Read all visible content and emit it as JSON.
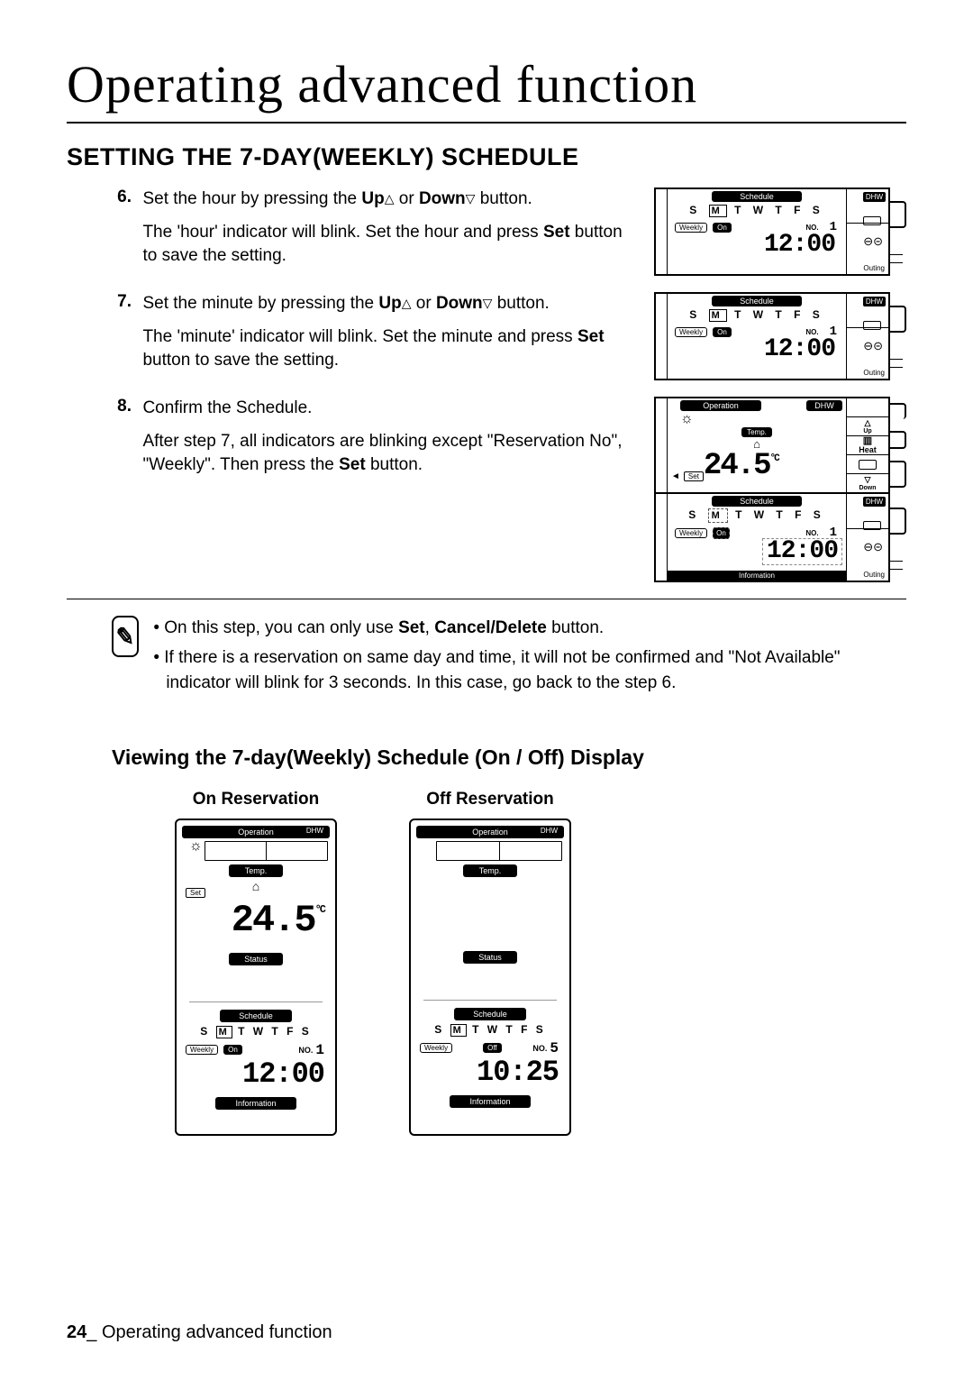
{
  "page": {
    "title": "Operating advanced function",
    "sectionHeading": "SETTING THE 7-DAY(WEEKLY) SCHEDULE",
    "footerNum": "24",
    "footerSep": "_ ",
    "footerText": "Operating advanced function"
  },
  "steps": {
    "s6": {
      "num": "6.",
      "line1a": "Set the hour by pressing the ",
      "up": "Up",
      "or": " or ",
      "down": "Down",
      "line1b": " button.",
      "line2a": "The 'hour' indicator will blink. Set the hour and press ",
      "set": "Set",
      "line2b": " button to save the setting."
    },
    "s7": {
      "num": "7.",
      "line1a": "Set the minute by pressing the ",
      "up": "Up",
      "or": " or ",
      "down": "Down",
      "line1b": " button.",
      "line2a": "The 'minute' indicator will blink. Set the minute and press ",
      "set": "Set",
      "line2b": " button to save the setting."
    },
    "s8": {
      "num": "8.",
      "line1": "Confirm the Schedule.",
      "line2a": "After step 7, all indicators are blinking except \"Reservation No\", \"Weekly\". Then press the ",
      "set": "Set",
      "line2b": " button."
    }
  },
  "notes": {
    "n1a": "• On this step, you can only use ",
    "n1set": "Set",
    "n1comma": ", ",
    "n1cancel": "Cancel/Delete",
    "n1b": " button.",
    "n2": "• If there is a reservation on same day and time, it will not be confirmed and \"Not Available\" indicator will blink for 3 seconds. In this case, go back to the step 6."
  },
  "subHeading": "Viewing the  7-day(Weekly) Schedule (On / Off) Display",
  "disp": {
    "onLabel": "On Reservation",
    "offLabel": "Off Reservation"
  },
  "lcd": {
    "schedule": "Schedule",
    "operation": "Operation",
    "temp": "Temp.",
    "status": "Status",
    "information": "Information",
    "dhw": "DHW",
    "days": "S M T W T F S",
    "daysPre": "S ",
    "dayM": "M",
    "daysPost": " T W T F S",
    "weekly": "Weekly",
    "on": "On",
    "off": "Off",
    "no": "NO.",
    "noVal1": "1",
    "noVal5": "5",
    "time1200": "12:00",
    "time1025": "10:25",
    "temp245": "24.5",
    "degC": "°C",
    "set": "Set",
    "outing": "Outing",
    "up": "Up",
    "down": "Down",
    "heat": "Heat",
    "car": "⊖⊝",
    "house": "⌂",
    "sun": "☼",
    "triUp": "△",
    "triDn": "▽",
    "pointer": "◄"
  }
}
